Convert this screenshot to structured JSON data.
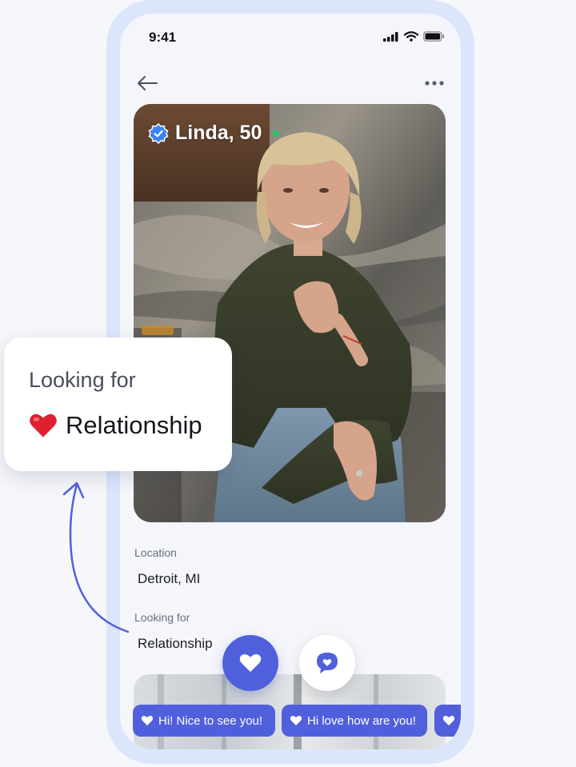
{
  "status_bar": {
    "time": "9:41"
  },
  "profile": {
    "name_age": "Linda, 50",
    "verified": true,
    "online": true,
    "location_label": "Location",
    "location_value": "Detroit, MI",
    "looking_for_label": "Looking for",
    "looking_for_value": "Relationship"
  },
  "quick_replies": [
    {
      "text": "Hi! Nice to see you!"
    },
    {
      "text": "Hi love how are you!"
    },
    {
      "text": ""
    }
  ],
  "callout": {
    "title": "Looking for",
    "value": "Relationship",
    "icon": "red-heart-icon"
  },
  "colors": {
    "accent": "#5060dd",
    "frame": "#dce6fb",
    "verified_badge": "#3b82f6",
    "online_dot": "#27c46b",
    "heart_red": "#e02030"
  }
}
